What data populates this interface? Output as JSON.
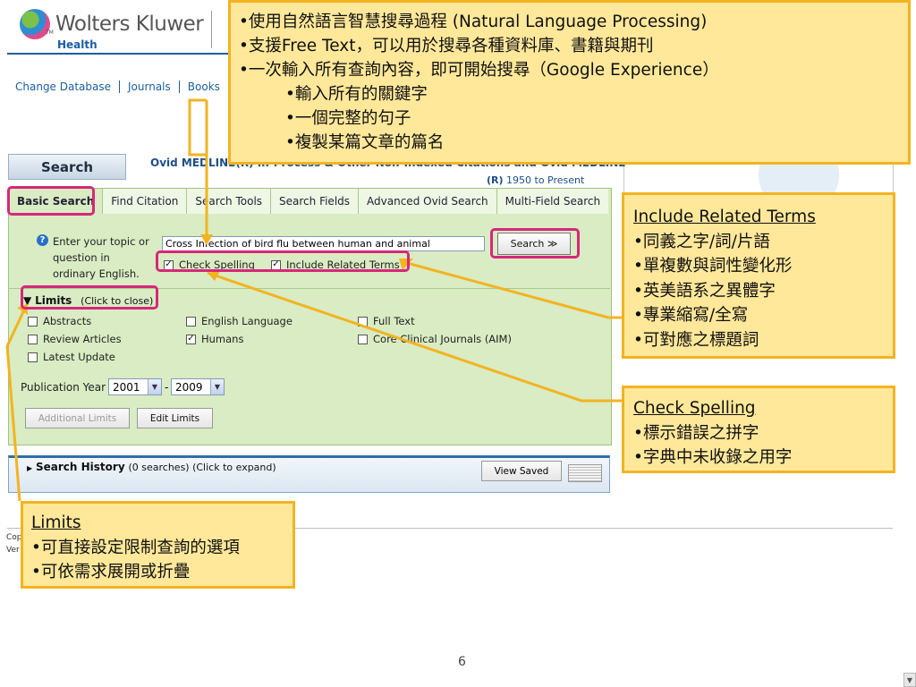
{
  "header": {
    "brand": "Wolters Kluwer",
    "brand_sub": "Health",
    "trademark": "TM",
    "nav_links": [
      "Change Database",
      "Journals",
      "Books"
    ]
  },
  "search": {
    "tab_label": "Search",
    "database_title": "Ovid MEDLINE(R) In-Process & Other Non-Indexed Citations and Ovid MEDLINE",
    "database_mark": "(R)",
    "database_range": "1950 to Present",
    "tabs": [
      {
        "label": "Basic Search",
        "active": true
      },
      {
        "label": "Find Citation"
      },
      {
        "label": "Search Tools"
      },
      {
        "label": "Search Fields"
      },
      {
        "label": "Advanced Ovid Search"
      },
      {
        "label": "Multi-Field Search"
      }
    ],
    "help_icon": "?",
    "help_text": "Enter your topic or question in ordinary English.",
    "query_value": "Cross Infection of bird flu between human and animal",
    "search_button": "Search ≫",
    "check_spelling": {
      "label": "Check Spelling",
      "checked": true
    },
    "include_related": {
      "label": "Include Related Terms",
      "checked": true
    }
  },
  "limits": {
    "toggle_label": "Limits",
    "toggle_hint": "(Click to close)",
    "options": [
      {
        "label": "Abstracts",
        "checked": false
      },
      {
        "label": "English Language",
        "checked": false
      },
      {
        "label": "Full Text",
        "checked": false
      },
      {
        "label": "Review Articles",
        "checked": false
      },
      {
        "label": "Humans",
        "checked": true
      },
      {
        "label": "Core Clinical Journals (AIM)",
        "checked": false
      },
      {
        "label": "Latest Update",
        "checked": false
      }
    ],
    "pub_year_label": "Publication Year",
    "year_from": "2001",
    "year_to": "2009",
    "year_separator": "-",
    "additional_limits": "Additional Limits",
    "edit_limits": "Edit Limits"
  },
  "history": {
    "label": "Search History",
    "detail": "(0 searches) (Click to expand)",
    "view_saved": "View Saved"
  },
  "footer": {
    "line1": "Cop",
    "line2": "Ver"
  },
  "page_number": "6",
  "callouts": {
    "top": [
      "•使用自然語言智慧搜尋過程 (Natural Language Processing)",
      "•支援Free Text，可以用於搜尋各種資料庫、書籍與期刊",
      "•一次輸入所有查詢內容，即可開始搜尋（Google Experience）",
      "•輸入所有的關鍵字",
      "•一個完整的句子",
      "•複製某篇文章的篇名"
    ],
    "related": {
      "heading": "Include Related Terms",
      "items": [
        "•同義之字/詞/片語",
        "•單複數與詞性變化形",
        "•英美語系之異體字",
        "•專業縮寫/全寫",
        "•可對應之標題詞"
      ]
    },
    "spelling": {
      "heading": "Check Spelling",
      "items": [
        "•標示錯誤之拼字",
        "•字典中未收錄之用字"
      ]
    },
    "limits": {
      "heading": "Limits",
      "items": [
        "•可直接設定限制查詢的選項",
        "•可依需求展開或折疊"
      ]
    }
  },
  "colors": {
    "brand_blue": "#1a5e9f",
    "panel_green": "#d9ecc3",
    "callout_fill": "#ffe89a",
    "callout_border": "#f3b321",
    "highlight_pink": "#d8277a"
  }
}
